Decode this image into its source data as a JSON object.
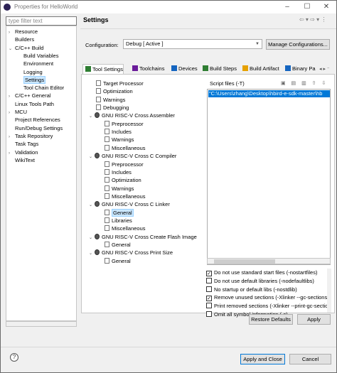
{
  "window": {
    "title": "Properties for HelloWorld",
    "controls": {
      "minimize": "–",
      "maximize": "☐",
      "close": "✕"
    }
  },
  "left": {
    "filter_placeholder": "type filter text",
    "tree": [
      {
        "label": "Resource",
        "arrow": "›",
        "level": 0
      },
      {
        "label": "Builders",
        "arrow": "",
        "level": 0
      },
      {
        "label": "C/C++ Build",
        "arrow": "⌄",
        "level": 0
      },
      {
        "label": "Build Variables",
        "arrow": "",
        "level": 1
      },
      {
        "label": "Environment",
        "arrow": "",
        "level": 1
      },
      {
        "label": "Logging",
        "arrow": "",
        "level": 1
      },
      {
        "label": "Settings",
        "arrow": "",
        "level": 1,
        "selected": true
      },
      {
        "label": "Tool Chain Editor",
        "arrow": "",
        "level": 1
      },
      {
        "label": "C/C++ General",
        "arrow": "›",
        "level": 0
      },
      {
        "label": "Linux Tools Path",
        "arrow": "",
        "level": 0
      },
      {
        "label": "MCU",
        "arrow": "›",
        "level": 0
      },
      {
        "label": "Project References",
        "arrow": "",
        "level": 0
      },
      {
        "label": "Run/Debug Settings",
        "arrow": "",
        "level": 0
      },
      {
        "label": "Task Repository",
        "arrow": "›",
        "level": 0
      },
      {
        "label": "Task Tags",
        "arrow": "",
        "level": 0
      },
      {
        "label": "Validation",
        "arrow": "›",
        "level": 0
      },
      {
        "label": "WikiText",
        "arrow": "",
        "level": 0
      }
    ]
  },
  "right": {
    "title": "Settings",
    "nav_arrows": "⇦ ▾ ⇨ ▾ ⋮",
    "configuration_label": "Configuration:",
    "configuration_value": "Debug  [ Active ]",
    "manage_button": "Manage Configurations...",
    "tabs": [
      {
        "label": "Tool Settings",
        "active": true,
        "icon_color": "#2e7d32"
      },
      {
        "label": "Toolchains",
        "active": false,
        "icon_color": "#6a1b9a"
      },
      {
        "label": "Devices",
        "active": false,
        "icon_color": "#1565c0"
      },
      {
        "label": "Build Steps",
        "active": false,
        "icon_color": "#2e7d32"
      },
      {
        "label": "Build Artifact",
        "active": false,
        "icon_color": "#e6a100"
      },
      {
        "label": "Binary Pa",
        "active": false,
        "icon_color": "#1565c0"
      }
    ],
    "tabs_more": "◂ ▸ ⁻",
    "tool_tree": [
      {
        "label": "Target Processor",
        "level": 0,
        "icon": "page"
      },
      {
        "label": "Optimization",
        "level": 0,
        "icon": "page"
      },
      {
        "label": "Warnings",
        "level": 0,
        "icon": "page"
      },
      {
        "label": "Debugging",
        "level": 0,
        "icon": "page"
      },
      {
        "label": "GNU RISC-V Cross Assembler",
        "level": 0,
        "icon": "gear",
        "arrow": "⌄"
      },
      {
        "label": "Preprocessor",
        "level": 1,
        "icon": "page"
      },
      {
        "label": "Includes",
        "level": 1,
        "icon": "page"
      },
      {
        "label": "Warnings",
        "level": 1,
        "icon": "page"
      },
      {
        "label": "Miscellaneous",
        "level": 1,
        "icon": "page"
      },
      {
        "label": "GNU RISC-V Cross C Compiler",
        "level": 0,
        "icon": "gear",
        "arrow": "⌄"
      },
      {
        "label": "Preprocessor",
        "level": 1,
        "icon": "page"
      },
      {
        "label": "Includes",
        "level": 1,
        "icon": "page"
      },
      {
        "label": "Optimization",
        "level": 1,
        "icon": "page"
      },
      {
        "label": "Warnings",
        "level": 1,
        "icon": "page"
      },
      {
        "label": "Miscellaneous",
        "level": 1,
        "icon": "page"
      },
      {
        "label": "GNU RISC-V Cross C Linker",
        "level": 0,
        "icon": "gear",
        "arrow": "⌄"
      },
      {
        "label": "General",
        "level": 1,
        "icon": "page",
        "selected": true
      },
      {
        "label": "Libraries",
        "level": 1,
        "icon": "page"
      },
      {
        "label": "Miscellaneous",
        "level": 1,
        "icon": "page"
      },
      {
        "label": "GNU RISC-V Cross Create Flash Image",
        "level": 0,
        "icon": "gear",
        "arrow": "⌄"
      },
      {
        "label": "General",
        "level": 1,
        "icon": "page"
      },
      {
        "label": "GNU RISC-V Cross Print Size",
        "level": 0,
        "icon": "gear",
        "arrow": "⌄"
      },
      {
        "label": "General",
        "level": 1,
        "icon": "page"
      }
    ],
    "script_files_label": "Script files (-T)",
    "script_icons": "▣ ▤ ▥ ⇧ ⇩",
    "script_entry": "\"C:\\Users\\zhang\\Desktop\\hbird-e-sdk-master\\hb",
    "options": [
      {
        "label": "Do not use standard start files (-nostartfiles)",
        "checked": true
      },
      {
        "label": "Do not use default libraries (-nodefaultlibs)",
        "checked": false
      },
      {
        "label": "No startup or default libs (-nostdlib)",
        "checked": false
      },
      {
        "label": "Remove unused sections (-Xlinker --gc-sections)",
        "checked": true
      },
      {
        "label": "Print removed sections (-Xlinker --print-gc-sections)",
        "checked": false
      },
      {
        "label": "Omit all symbol information (-s)",
        "checked": false
      }
    ],
    "restore_defaults": "Restore Defaults",
    "apply": "Apply"
  },
  "footer": {
    "help_icon": "?",
    "apply_and_close": "Apply and Close",
    "cancel": "Cancel"
  }
}
